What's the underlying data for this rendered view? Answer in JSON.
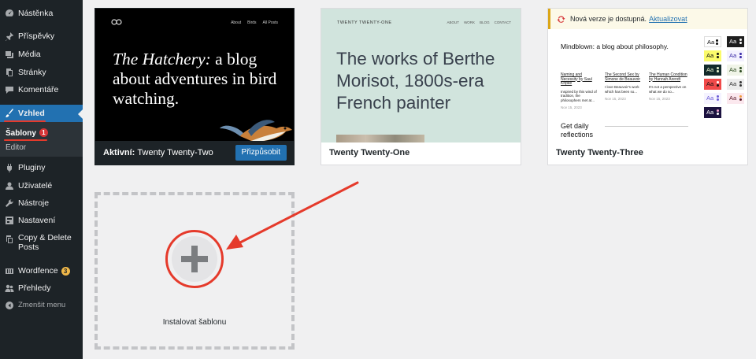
{
  "sidebar": {
    "items": [
      {
        "label": "Nástěnka",
        "icon": "dashboard-icon"
      },
      {
        "label": "Příspěvky",
        "icon": "pin-icon"
      },
      {
        "label": "Média",
        "icon": "media-icon"
      },
      {
        "label": "Stránky",
        "icon": "page-icon"
      },
      {
        "label": "Komentáře",
        "icon": "comment-icon"
      },
      {
        "label": "Vzhled",
        "icon": "brush-icon"
      },
      {
        "label": "Pluginy",
        "icon": "plugin-icon"
      },
      {
        "label": "Uživatelé",
        "icon": "user-icon"
      },
      {
        "label": "Nástroje",
        "icon": "wrench-icon"
      },
      {
        "label": "Nastavení",
        "icon": "settings-icon"
      },
      {
        "label": "Copy & Delete Posts",
        "icon": "copy-icon"
      },
      {
        "label": "Wordfence",
        "icon": "wordfence-icon",
        "badge": "3"
      },
      {
        "label": "Přehledy",
        "icon": "insights-icon"
      },
      {
        "label": "Zmenšit menu",
        "icon": "collapse-icon"
      }
    ],
    "submenu": [
      {
        "label": "Šablony",
        "badge": "1"
      },
      {
        "label": "Editor"
      }
    ]
  },
  "themes": [
    {
      "name": "Twenty Twenty-Two",
      "active_prefix": "Aktivní:",
      "button": "Přizpůsobit",
      "preview": {
        "nav": [
          "About",
          "Birds",
          "All Posts"
        ],
        "title_italic": "The Hatchery:",
        "title_rest": " a blog about adventures in bird watching."
      }
    },
    {
      "name": "Twenty Twenty-One",
      "preview": {
        "brand": "TWENTY TWENTY-ONE",
        "nav": [
          "ABOUT",
          "WORK",
          "BLOG",
          "CONTACT"
        ],
        "title": "The works of Berthe Morisot, 1800s-era French painter"
      }
    },
    {
      "name": "Twenty Twenty-Three",
      "notice": {
        "text": "Nová verze je dostupná.",
        "link": "Aktualizovat"
      },
      "preview": {
        "title": "Mindblown: a blog about philosophy.",
        "posts": [
          {
            "title": "Naming and Necessity by Saul Kripke",
            "excerpt": "Inspired by this wind of tradition, the philosophers met at...",
            "date": "Nov 15, 2023"
          },
          {
            "title": "The Second Sex by Simone de Beauvoir",
            "excerpt": "I love Beauvoir's work which has been so...",
            "date": "Nov 15, 2023"
          },
          {
            "title": "The Human Condition by Hannah Arendt",
            "excerpt": "It's not a perspective on what we do so...",
            "date": "Nov 15, 2023"
          }
        ],
        "footer_text": "Get daily reflections",
        "style_variation_label": "Aa"
      }
    }
  ],
  "add_theme": {
    "label": "Instalovat šablonu"
  },
  "colors": {
    "sidebar": "#1d2327",
    "active": "#2271b1",
    "annotation": "#e53a2b"
  }
}
